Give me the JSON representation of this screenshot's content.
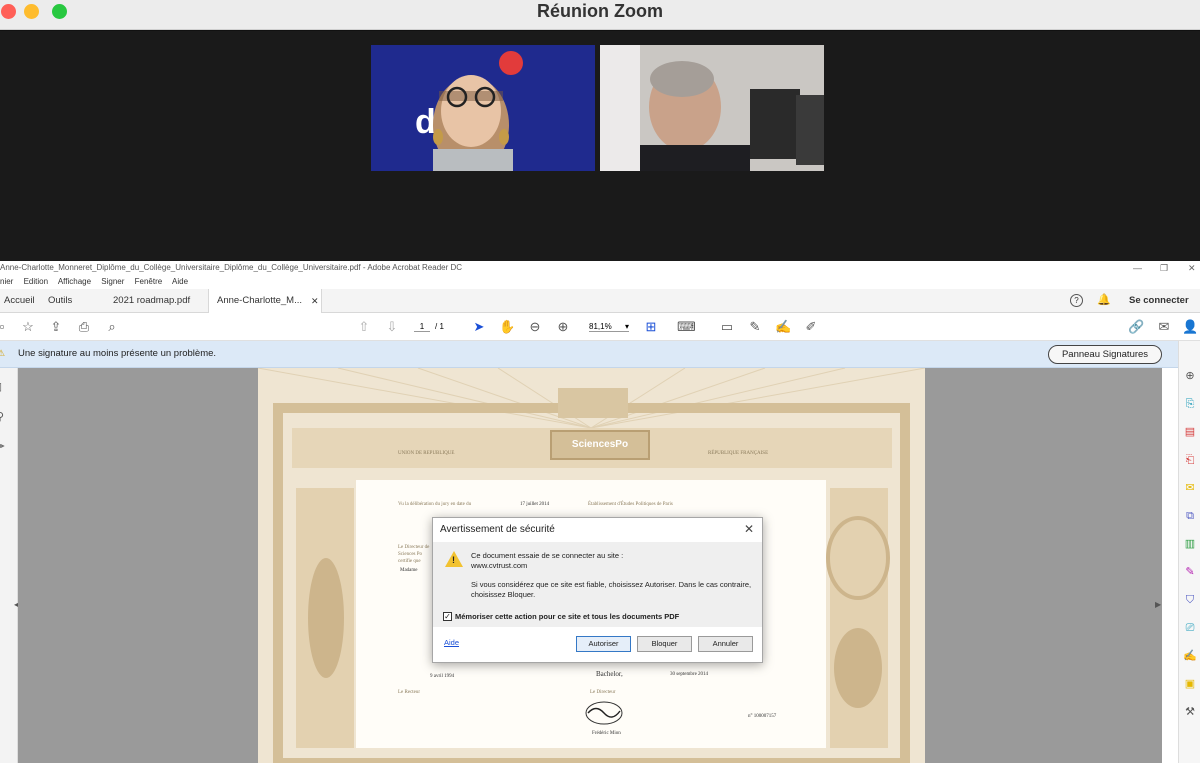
{
  "zoom": {
    "title": "Réunion Zoom"
  },
  "acrobat": {
    "window_title": "Anne-Charlotte_Monneret_Diplôme_du_Collège_Universitaire_Diplôme_du_Collège_Universitaire.pdf - Adobe Acrobat Reader DC",
    "menu": [
      "nier",
      "Edition",
      "Affichage",
      "Signer",
      "Fenêtre",
      "Aide"
    ],
    "tabs": {
      "home": "Accueil",
      "tools": "Outils",
      "doc1": "2021 roadmap.pdf",
      "doc2": "Anne-Charlotte_M..."
    },
    "signin": "Se connecter",
    "page_current": "1",
    "page_total": "/ 1",
    "zoom_level": "81,1%",
    "sig_message": "Une signature au moins présente un problème.",
    "sig_panel_button": "Panneau Signatures"
  },
  "diploma": {
    "logo": "SciencesPo",
    "text_ecole": "Établissement d'Études Politiques de Paris",
    "text_date": "17 juillet 2014",
    "text_label": "Vu la délibération du jury en date du",
    "text_madame": "Madame",
    "text_bachelor": "Bachelor,",
    "text_date2": "30 septembre 2014",
    "text_birth": "9 avril 1994",
    "text_number": "n° 100007157",
    "text_director": "Le Directeur",
    "text_recteur": "Le Recteur",
    "text_left_block": "Le Directeur de Sciences Po certifie que",
    "text_surname": "Frédéric Mion",
    "header_left": "UNION DE REPUBLIQUE",
    "header_right": "RÉPUBLIQUE FRANÇAISE"
  },
  "dialog": {
    "title": "Avertissement de sécurité",
    "line1": "Ce document essaie de se connecter au site :",
    "site": "www.cvtrust.com",
    "line2": "Si vous considérez que ce site est fiable, choisissez Autoriser. Dans le cas contraire, choisissez Bloquer.",
    "checkbox_label": "Mémoriser cette action pour ce site et tous les documents PDF",
    "checkbox_checked": true,
    "help": "Aide",
    "allow": "Autoriser",
    "block": "Bloquer",
    "cancel": "Annuler"
  },
  "colors": {
    "warning_bar": "#dce9f7",
    "accent": "#1a4fd6",
    "zoom_tile_bg": "#1e2a8c"
  }
}
